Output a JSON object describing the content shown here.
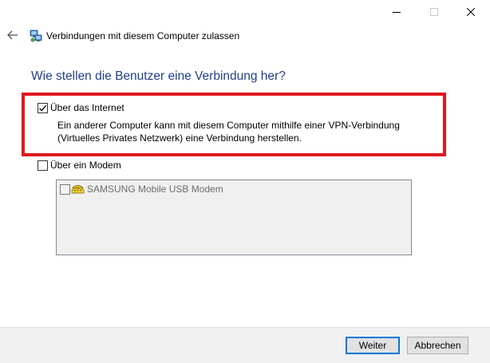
{
  "window": {
    "title": "Verbindungen mit diesem Computer zulassen",
    "caption_buttons": [
      "minimize-icon",
      "maximize-icon",
      "close-icon"
    ]
  },
  "heading": "Wie stellen die Benutzer eine Verbindung her?",
  "options": {
    "internet": {
      "label": "Über das Internet",
      "checked": true,
      "description_line1": "Ein anderer Computer kann mit diesem Computer mithilfe einer VPN-Verbindung",
      "description_line2": "(Virtuelles Privates Netzwerk) eine Verbindung herstellen."
    },
    "modem": {
      "label": "Über ein Modem",
      "checked": false,
      "devices": [
        {
          "label": "SAMSUNG Mobile USB Modem",
          "checked": false,
          "icon": "modem-icon"
        }
      ]
    }
  },
  "buttons": {
    "next": "Weiter",
    "cancel": "Abbrechen"
  },
  "colors": {
    "heading": "#1e3f8c",
    "highlight": "#e0171f",
    "default_button_border": "#0078d7"
  }
}
